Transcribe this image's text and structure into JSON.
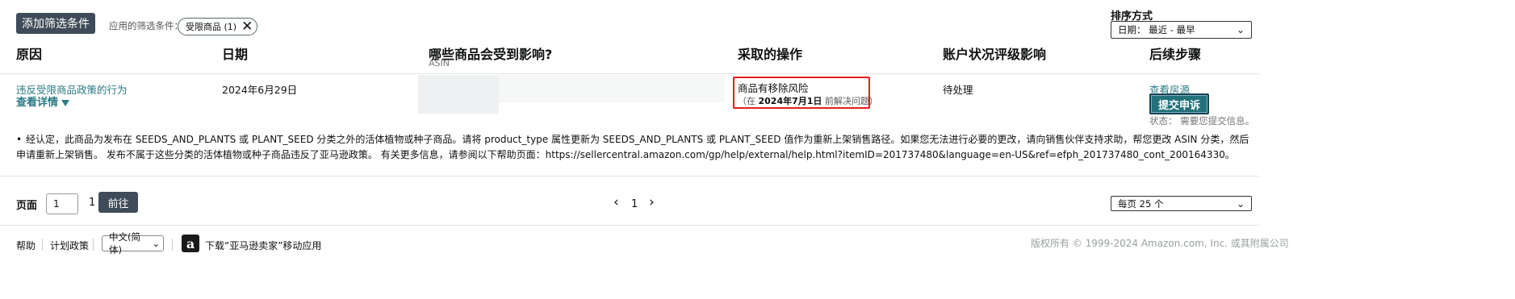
{
  "filters": {
    "add_button": "添加筛选条件",
    "applied_label": "应用的筛选条件：",
    "chip_label": "受限商品 (1)",
    "chip_close": "✕"
  },
  "sort": {
    "title": "排序方式",
    "selected": "日期： 最近 - 最早",
    "chevron": "⌄"
  },
  "table": {
    "headers": {
      "reason": "原因",
      "date": "日期",
      "affected": "哪些商品会受到影响?",
      "affected_sub": "ASIN",
      "action": "采取的操作",
      "account_impact": "账户状况评级影响",
      "next_steps": "后续步骤"
    },
    "row": {
      "reason_link": "违反受限商品政策的行为",
      "details_link": "查看详情",
      "date": "2024年6月29日",
      "action_title": "商品有移除风险",
      "action_note_prefix": "（在 ",
      "action_note_date": "2024年7月1日",
      "action_note_suffix": " 前解决问题）",
      "impact": "待处理",
      "view_source": "查看房源",
      "appeal_button": "提交申诉",
      "status": "状态：  需要您提交信息。"
    },
    "description": "经认定，此商品为发布在 SEEDS_AND_PLANTS 或 PLANT_SEED 分类之外的活体植物或种子商品。请将 product_type 属性更新为 SEEDS_AND_PLANTS 或 PLANT_SEED 值作为重新上架销售路径。如果您无法进行必要的更改，请向销售伙伴支持求助，帮您更改 ASIN 分类，然后申请重新上架销售。 发布不属于这些分类的活体植物或种子商品违反了亚马逊政策。 有关更多信息，请参阅以下帮助页面：https://sellercentral.amazon.com/gp/help/external/help.html?itemID=201737480&language=en-US&ref=efph_201737480_cont_200164330。"
  },
  "pagination": {
    "page_label": "页面",
    "page_input": "1",
    "total_pages": "1",
    "go_button": "前往",
    "prev": "‹",
    "current": "1",
    "next": "›",
    "per_page": "每页 25 个"
  },
  "footer": {
    "help": "帮助",
    "policies": "计划政策",
    "language": "中文(简体)",
    "app_icon": "a",
    "app_text": "下载“亚马逊卖家”移动应用",
    "copyright": "版权所有 © 1999-2024 Amazon.com, Inc. 或其附属公司"
  },
  "colors": {
    "dark_button": "#3f4b58",
    "teal_button": "#22717a",
    "link": "#2c7a85",
    "highlight_box": "#e02020"
  }
}
